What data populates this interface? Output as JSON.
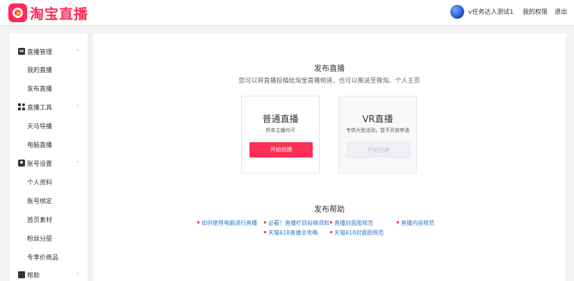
{
  "header": {
    "logo_text": "淘宝直播",
    "user_name": "v任务达人测试1",
    "my_permissions": "我的权限",
    "logout": "退出"
  },
  "sidebar": {
    "sections": [
      {
        "label": "直播管理",
        "icon": "live-icon",
        "items": [
          "我的直播",
          "发布直播"
        ]
      },
      {
        "label": "直播工具",
        "icon": "tools-icon",
        "items": [
          "天马导播",
          "电脑直播"
        ]
      },
      {
        "label": "账号设置",
        "icon": "account-icon",
        "items": [
          "个人资料",
          "账号绑定",
          "首页素材",
          "粉丝分层",
          "专享价商品"
        ]
      },
      {
        "label": "帮助",
        "icon": "help-icon",
        "items": []
      }
    ]
  },
  "main": {
    "publish_title": "发布直播",
    "publish_subtitle": "您可以将直播投稿给淘宝直播频道，也可以推送至微淘、个人主页",
    "cards": [
      {
        "title": "普通直播",
        "desc": "所有主播均可",
        "button": "开始创建"
      },
      {
        "title": "VR直播",
        "desc": "专供大型活动，暂不开放申请",
        "button": "开始创建"
      }
    ],
    "help_title": "发布帮助",
    "help_links": [
      "如何使用电脑进行直播",
      "必看！直播栏目投稿须知",
      "直播封面图规范",
      "直播内容规范",
      "天猫618直播全攻略",
      "天猫618封面图规范"
    ]
  },
  "colors": {
    "brand": "#ff2a55",
    "link": "#2d78c8"
  }
}
